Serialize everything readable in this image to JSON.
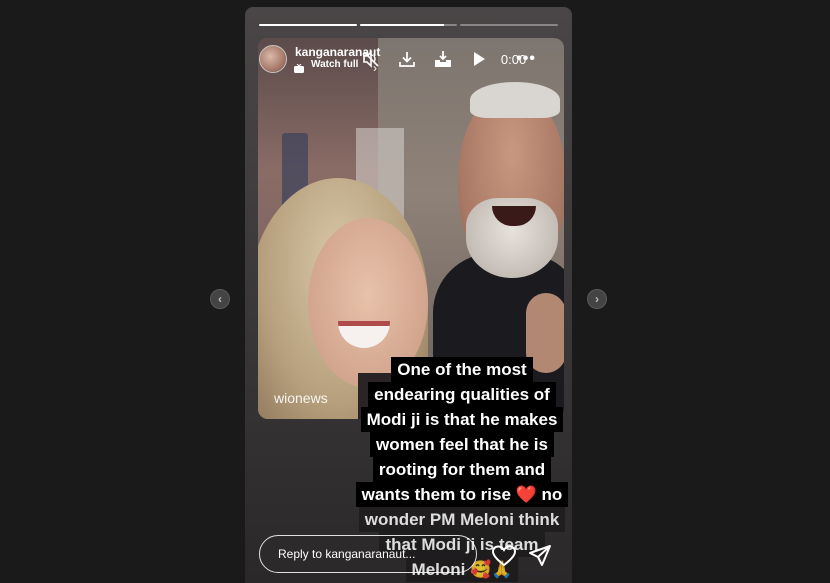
{
  "story": {
    "progress": [
      1.0,
      0.86,
      0.0
    ],
    "user": {
      "username": "kanganaranaut",
      "link_label": "Watch full",
      "chevron": "chevron-right-icon",
      "avatar": "avatar"
    },
    "controls": {
      "mute_icon": "speaker-muted-icon",
      "download_icon": "download-icon",
      "download_all_icon": "download-tray-icon",
      "play_icon": "play-icon",
      "time": "0:00",
      "more_label": "•••"
    },
    "video": {
      "watermark": "wionews"
    },
    "caption": {
      "lines": [
        "One of the most",
        "endearing qualities of",
        "Modi ji is that he makes",
        "women feel that he is",
        "rooting for them and",
        "wants them to rise ❤️ no",
        "wonder PM Meloni think",
        "that Modi ji is team",
        "Meloni 🥰🙏"
      ]
    },
    "footer": {
      "reply_placeholder": "Reply to kanganaranaut...",
      "like_icon": "heart-icon",
      "share_icon": "send-icon"
    }
  },
  "nav": {
    "prev_label": "‹",
    "next_label": "›"
  },
  "colors": {
    "background": "#1a1a1a",
    "caption_bg": "#000000",
    "text": "#ffffff"
  }
}
